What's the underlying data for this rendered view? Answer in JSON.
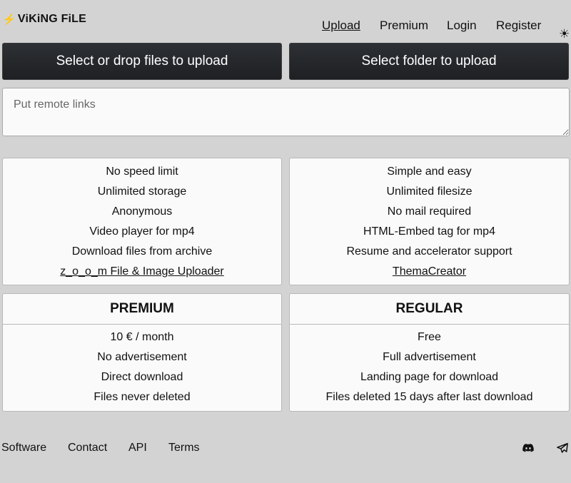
{
  "header": {
    "logo_text": "ViKiNG FiLE",
    "logo_icon": "lightning-bolt-icon",
    "nav": {
      "upload": "Upload",
      "premium": "Premium",
      "login": "Login",
      "register": "Register",
      "theme_icon": "sun-icon"
    }
  },
  "upload": {
    "files_button": "Select or drop files to upload",
    "folder_button": "Select folder to upload",
    "remote_placeholder": "Put remote links"
  },
  "features": {
    "left": [
      "No speed limit",
      "Unlimited storage",
      "Anonymous",
      "Video player for mp4",
      "Download files from archive"
    ],
    "left_link": "z_o_o_m File & Image Uploader",
    "right": [
      "Simple and easy",
      "Unlimited filesize",
      "No mail required",
      "HTML-Embed tag for mp4",
      "Resume and accelerator support"
    ],
    "right_link": "ThemaCreator"
  },
  "plans": {
    "premium": {
      "title": "PREMIUM",
      "items": [
        "10 € / month",
        "No advertisement",
        "Direct download",
        "Files never deleted"
      ]
    },
    "regular": {
      "title": "REGULAR",
      "items": [
        "Free",
        "Full advertisement",
        "Landing page for download",
        "Files deleted 15 days after last download"
      ]
    }
  },
  "footer": {
    "software": "Software",
    "contact": "Contact",
    "api": "API",
    "terms": "Terms",
    "discord_icon": "discord-icon",
    "telegram_icon": "telegram-icon"
  }
}
